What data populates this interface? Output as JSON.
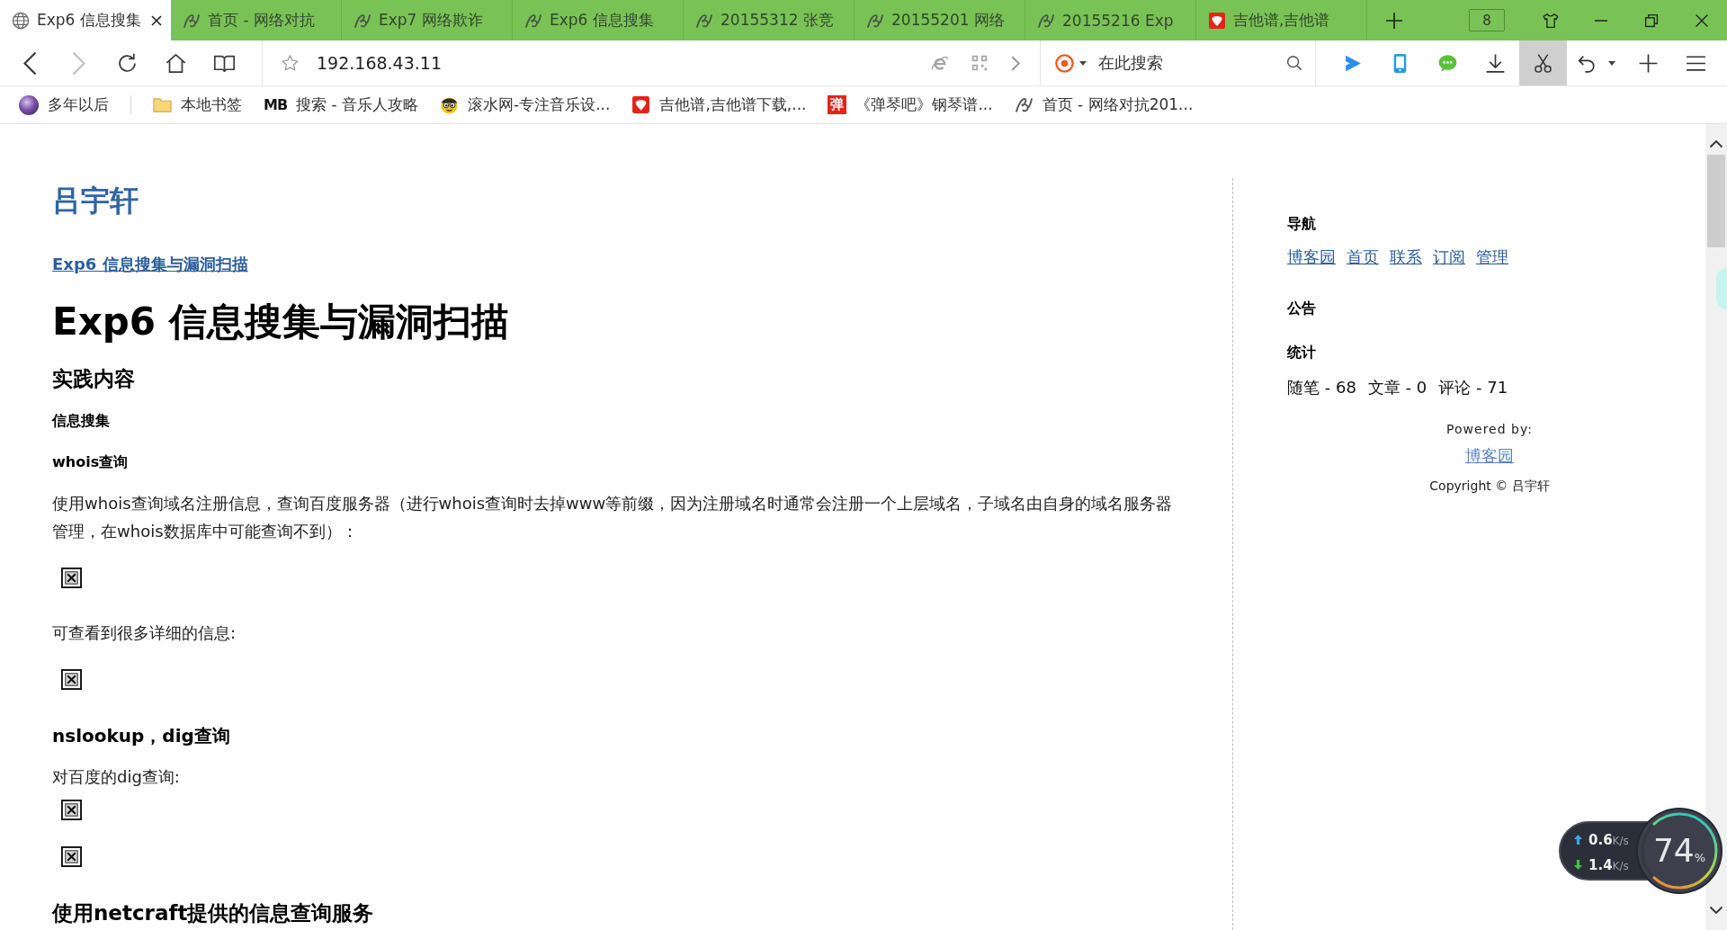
{
  "tab_bar": {
    "tabs": [
      {
        "title": "Exp6 信息搜集",
        "kind": "page",
        "selected": true
      },
      {
        "title": "首页 - 网络对抗",
        "kind": "blog",
        "selected": false
      },
      {
        "title": "Exp7 网络欺诈",
        "kind": "blog",
        "selected": false
      },
      {
        "title": "Exp6 信息搜集",
        "kind": "blog",
        "selected": false
      },
      {
        "title": "20155312 张竞",
        "kind": "blog",
        "selected": false
      },
      {
        "title": "20155201 网络",
        "kind": "blog",
        "selected": false
      },
      {
        "title": "20155216 Exp",
        "kind": "blog",
        "selected": false
      },
      {
        "title": "吉他谱,吉他谱",
        "kind": "music",
        "selected": false
      }
    ],
    "tab_count": "8"
  },
  "toolbar": {
    "nav_buttons": [
      {
        "kind": "back",
        "disabled": false
      },
      {
        "kind": "forward",
        "disabled": true
      },
      {
        "kind": "reload",
        "disabled": false
      },
      {
        "kind": "home",
        "disabled": false
      },
      {
        "kind": "reader",
        "disabled": false
      }
    ],
    "address": "192.168.43.11",
    "search_placeholder": "在此搜索",
    "tools": [
      {
        "kind": "video",
        "selected": false
      },
      {
        "kind": "phone",
        "selected": false
      },
      {
        "kind": "chat",
        "selected": false
      },
      {
        "kind": "download",
        "selected": false
      },
      {
        "kind": "screenshot",
        "selected": true
      },
      {
        "kind": "undo",
        "selected": false
      },
      {
        "kind": "add",
        "selected": false
      },
      {
        "kind": "menu",
        "selected": false
      }
    ]
  },
  "bookmarks_bar": {
    "profile": "多年以后",
    "items": [
      {
        "label": "本地书签",
        "kind": "folder"
      },
      {
        "label": "搜索 - 音乐人攻略",
        "kind": "text_logo",
        "logo": "MB"
      },
      {
        "label": "滚水网-专注音乐设...",
        "kind": "mascot"
      },
      {
        "label": "吉他谱,吉他谱下载,...",
        "kind": "music"
      },
      {
        "label": "《弹琴吧》钢琴谱...",
        "kind": "badge",
        "logo": "弹"
      },
      {
        "label": "首页 - 网络对抗201...",
        "kind": "blog"
      }
    ]
  },
  "page": {
    "blog_title": "吕宇轩",
    "post_link": "Exp6 信息搜集与漏洞扫描",
    "post_title": "Exp6 信息搜集与漏洞扫描",
    "blocks": [
      {
        "kind": "h2",
        "text": "实践内容"
      },
      {
        "kind": "h4",
        "text": "信息搜集"
      },
      {
        "kind": "h4",
        "text": "whois查询"
      },
      {
        "kind": "p",
        "text": "使用whois查询域名注册信息，查询百度服务器（进行whois查询时去掉www等前缀，因为注册域名时通常会注册一个上层域名，子域名由自身的域名服务器管理，在whois数据库中可能查询不到）："
      },
      {
        "kind": "image"
      },
      {
        "kind": "p",
        "text": "可查看到很多详细的信息:"
      },
      {
        "kind": "image"
      },
      {
        "kind": "h3",
        "text": "nslookup，dig查询"
      },
      {
        "kind": "p",
        "text": "对百度的dig查询:"
      },
      {
        "kind": "image"
      },
      {
        "kind": "image"
      },
      {
        "kind": "h2",
        "text": "使用netcraft提供的信息查询服务"
      }
    ]
  },
  "sidebar": {
    "nav_heading": "导航",
    "nav_links": [
      "博客园",
      "首页",
      "联系",
      "订阅",
      "管理"
    ],
    "notice_heading": "公告",
    "stats_heading": "统计",
    "stats": [
      "随笔 - 68",
      "文章 - 0",
      "评论 - 71"
    ],
    "powered_by": "Powered by:",
    "powered_link": "博客园",
    "copyright": "Copyright © 吕宇轩"
  },
  "speed_widget": {
    "upload": "**0.6**K/s",
    "download": "**1.4**K/s",
    "memory": "74$_{%}$",
    "level": 0.74
  }
}
